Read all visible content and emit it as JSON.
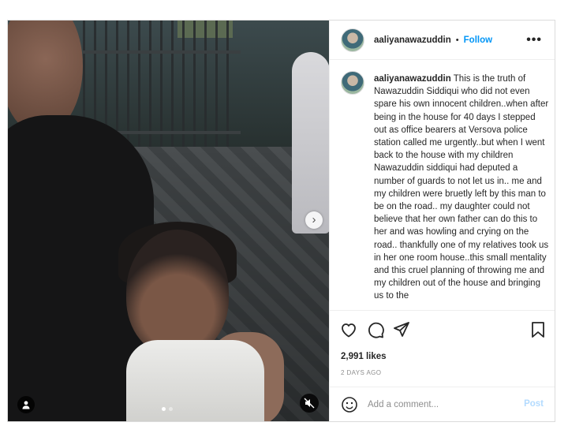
{
  "post": {
    "username": "aaliyanawazuddin",
    "separator": "•",
    "follow_label": "Follow",
    "more_label": "•••",
    "caption": {
      "username": "aaliyanawazuddin",
      "text": "This is the truth of Nawazuddin Siddiqui who did not even spare his own innocent children..when after being in the house for 40 days I stepped out as office bearers at Versova police station called me urgently..but when I went back to the house with my children Nawazuddin siddiqui had deputed a number of guards to not let us in.. me and my children were bruetly left by this man to be on the road.. my daughter could not believe that her own father can do this to her and was howling and crying on the road.. thankfully one of my relatives took us in her one room house..this small mentality and this cruel planning of throwing me and my children out of the house and bringing us to the"
    },
    "likes": "2,991 likes",
    "date": "2 DAYS AGO",
    "comment_placeholder": "Add a comment...",
    "post_button": "Post",
    "next_arrow": "›",
    "carousel": {
      "count": 2,
      "active_index": 0
    },
    "icons": [
      "heart-icon",
      "comment-icon",
      "share-icon",
      "bookmark-icon",
      "emoji-icon",
      "tag-user-icon",
      "mute-icon",
      "chevron-right-icon"
    ]
  }
}
